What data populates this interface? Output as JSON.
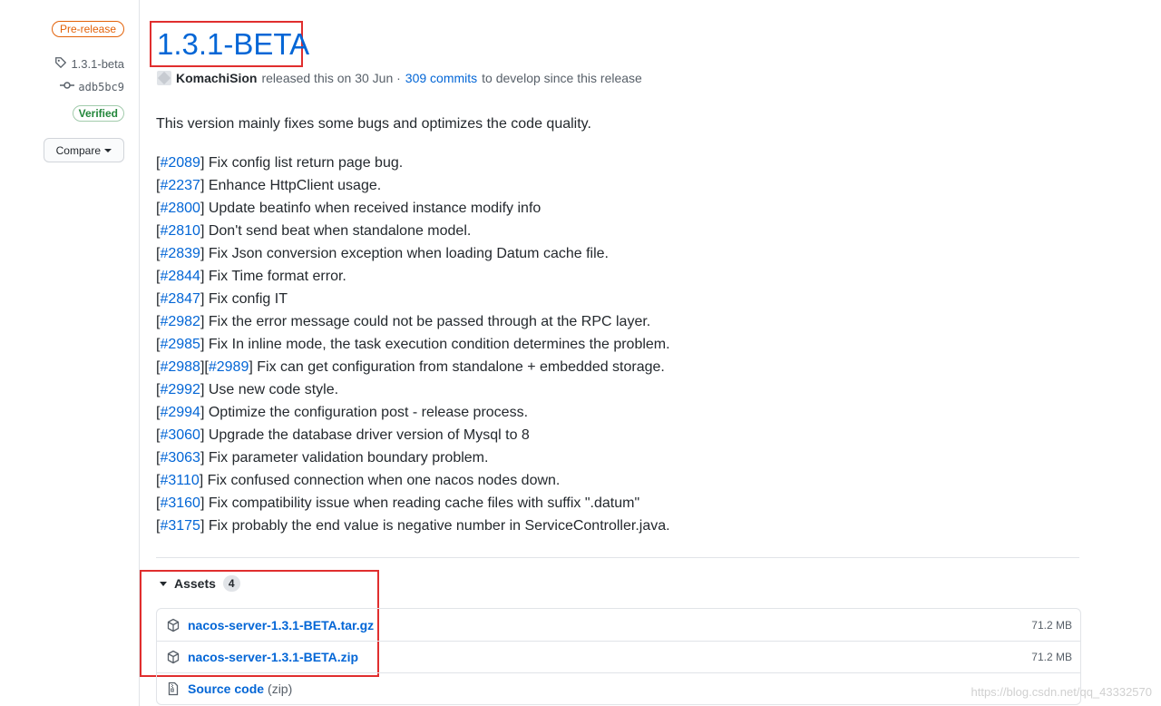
{
  "sidebar": {
    "badge": "Pre-release",
    "tag": "1.3.1-beta",
    "commit": "adb5bc9",
    "verified": "Verified",
    "compare": "Compare"
  },
  "release": {
    "title": "1.3.1-BETA",
    "author": "KomachiSion",
    "released_text": "released this on 30 Jun ·",
    "commits_link": "309 commits",
    "commits_suffix": "to develop since this release",
    "intro": "This version mainly fixes some bugs and optimizes the code quality."
  },
  "notes": [
    {
      "issues": [
        "#2089"
      ],
      "text": " Fix config list return page bug."
    },
    {
      "issues": [
        "#2237"
      ],
      "text": " Enhance HttpClient usage."
    },
    {
      "issues": [
        "#2800"
      ],
      "text": " Update beatinfo when received instance modify info"
    },
    {
      "issues": [
        "#2810"
      ],
      "text": " Don't send beat when standalone model."
    },
    {
      "issues": [
        "#2839"
      ],
      "text": " Fix Json conversion exception when loading Datum cache file."
    },
    {
      "issues": [
        "#2844"
      ],
      "text": " Fix Time format error."
    },
    {
      "issues": [
        "#2847"
      ],
      "text": " Fix config IT"
    },
    {
      "issues": [
        "#2982"
      ],
      "text": " Fix the error message could not be passed through at the RPC layer."
    },
    {
      "issues": [
        "#2985"
      ],
      "text": " Fix In inline mode, the task execution condition determines the problem."
    },
    {
      "issues": [
        "#2988",
        "#2989"
      ],
      "text": " Fix can get configuration from standalone + embedded storage."
    },
    {
      "issues": [
        "#2992"
      ],
      "text": " Use new code style."
    },
    {
      "issues": [
        "#2994"
      ],
      "text": " Optimize the configuration post - release process."
    },
    {
      "issues": [
        "#3060"
      ],
      "text": " Upgrade the database driver version of Mysql to 8"
    },
    {
      "issues": [
        "#3063"
      ],
      "text": " Fix parameter validation boundary problem."
    },
    {
      "issues": [
        "#3110"
      ],
      "text": " Fix confused connection when one nacos nodes down."
    },
    {
      "issues": [
        "#3160"
      ],
      "text": " Fix compatibility issue when reading cache files with suffix \".datum\""
    },
    {
      "issues": [
        "#3175"
      ],
      "text": " Fix probably the end value is negative number in ServiceController.java."
    }
  ],
  "assets": {
    "label": "Assets",
    "count": "4",
    "files": [
      {
        "name": "nacos-server-1.3.1-BETA.tar.gz",
        "size": "71.2 MB"
      },
      {
        "name": "nacos-server-1.3.1-BETA.zip",
        "size": "71.2 MB"
      }
    ],
    "source": {
      "name": "Source code",
      "suffix": "(zip)"
    }
  },
  "watermark": "https://blog.csdn.net/qq_43332570",
  "colors": {
    "link": "#0366d6",
    "prerelease": "#e36209",
    "verified": "#22863a",
    "highlight": "#e02e2e"
  }
}
